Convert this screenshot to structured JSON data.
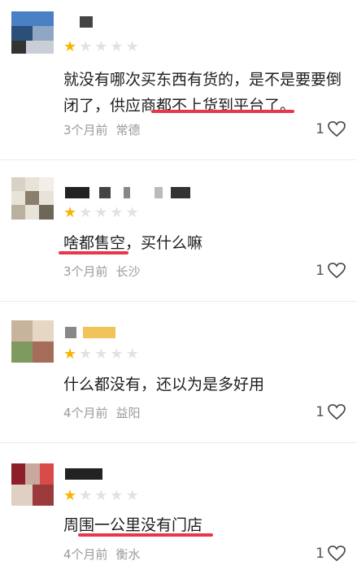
{
  "reviews": [
    {
      "rating": 1,
      "content": "就没有哪次买东西有货的，是不是要要倒闭了，供应商都不上货到平台了。",
      "time": "3个月前",
      "city": "常德",
      "likes": "1"
    },
    {
      "rating": 1,
      "content": "啥都售空，买什么嘛",
      "time": "3个月前",
      "city": "长沙",
      "likes": "1"
    },
    {
      "rating": 1,
      "content": "什么都没有，还以为是多好用",
      "time": "4个月前",
      "city": "益阳",
      "likes": "1"
    },
    {
      "rating": 1,
      "content": "周围一公里没有门店",
      "time": "4个月前",
      "city": "衡水",
      "likes": "1"
    }
  ],
  "colors": {
    "star_active": "#f7b500",
    "star_inactive": "#e2e2e2",
    "annotation": "#e8364a"
  },
  "icons": {
    "star": "star-icon",
    "like": "heart-outline-icon"
  }
}
